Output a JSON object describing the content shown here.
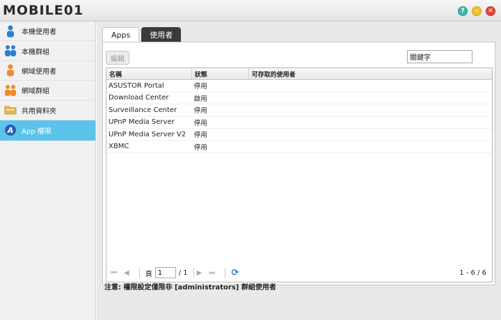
{
  "window": {
    "logo_text": "MOBILE01",
    "logo_badge": "01",
    "controls": {
      "help": "?",
      "minimize": "–",
      "close": "✕"
    }
  },
  "sidebar": {
    "items": [
      {
        "label": "本機使用者",
        "icon": "user-icon"
      },
      {
        "label": "本機群組",
        "icon": "group-icon"
      },
      {
        "label": "網域使用者",
        "icon": "domain-user-icon"
      },
      {
        "label": "網域群組",
        "icon": "domain-group-icon"
      },
      {
        "label": "共用資料夾",
        "icon": "folder-icon"
      },
      {
        "label": "App 權限",
        "icon": "app-privilege-icon",
        "active": true
      }
    ]
  },
  "tabs": [
    {
      "label": "Apps",
      "active": true
    },
    {
      "label": "使用者",
      "active": false
    }
  ],
  "toolbar": {
    "edit_label": "編輯",
    "search_value": "關鍵字"
  },
  "table": {
    "headers": [
      "名稱",
      "狀態",
      "可存取的使用者"
    ],
    "rows": [
      {
        "name": "ASUSTOR Portal",
        "status": "停用",
        "users": ""
      },
      {
        "name": "Download Center",
        "status": "啟用",
        "users": ""
      },
      {
        "name": "Surveillance Center",
        "status": "停用",
        "users": ""
      },
      {
        "name": "UPnP Media Server",
        "status": "停用",
        "users": ""
      },
      {
        "name": "UPnP Media Server V2",
        "status": "停用",
        "users": ""
      },
      {
        "name": "XBMC",
        "status": "停用",
        "users": ""
      }
    ]
  },
  "pager": {
    "page_label": "頁",
    "page_value": "1",
    "total_pages": "/ 1",
    "count": "1 - 6 / 6"
  },
  "note": "注意: 權限設定僅限非 [administrators] 群組使用者",
  "colors": {
    "active_sidebar": "#5cc4ea",
    "tab_dark": "#3a3a3a",
    "refresh": "#2a7fd4"
  }
}
